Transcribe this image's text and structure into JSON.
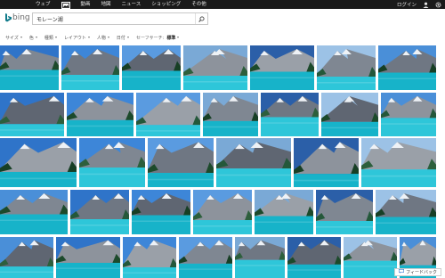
{
  "topnav": {
    "items": [
      {
        "label": "ウェブ",
        "active": false
      },
      {
        "label": "画像",
        "active": true
      },
      {
        "label": "動画",
        "active": false
      },
      {
        "label": "地図",
        "active": false
      },
      {
        "label": "ニュース",
        "active": false
      },
      {
        "label": "ショッピング",
        "active": false
      },
      {
        "label": "その他",
        "active": false
      }
    ],
    "login_label": "ログイン",
    "user_icon": "user-icon",
    "settings_icon": "gear-icon"
  },
  "header": {
    "logo_text": "bing",
    "search_value": "モレーン湖"
  },
  "filters": [
    {
      "label": "サイズ",
      "style": "normal"
    },
    {
      "label": "色",
      "style": "normal"
    },
    {
      "label": "種類",
      "style": "normal"
    },
    {
      "label": "レイアウト",
      "style": "normal"
    },
    {
      "label": "人物",
      "style": "normal"
    },
    {
      "label": "日付",
      "style": "normal"
    },
    {
      "label": "セーフサーチ:",
      "style": "plain"
    },
    {
      "label": "標準",
      "style": "bold"
    }
  ],
  "feedback_label": "フィードバック",
  "colors": {
    "topbar": "#1a1a1a",
    "lake": "#1fb2c8",
    "sky": "#3d7fd0",
    "forest": "#1f4a2c",
    "mountain": "#8a8f99",
    "snow": "#eef2f6"
  }
}
